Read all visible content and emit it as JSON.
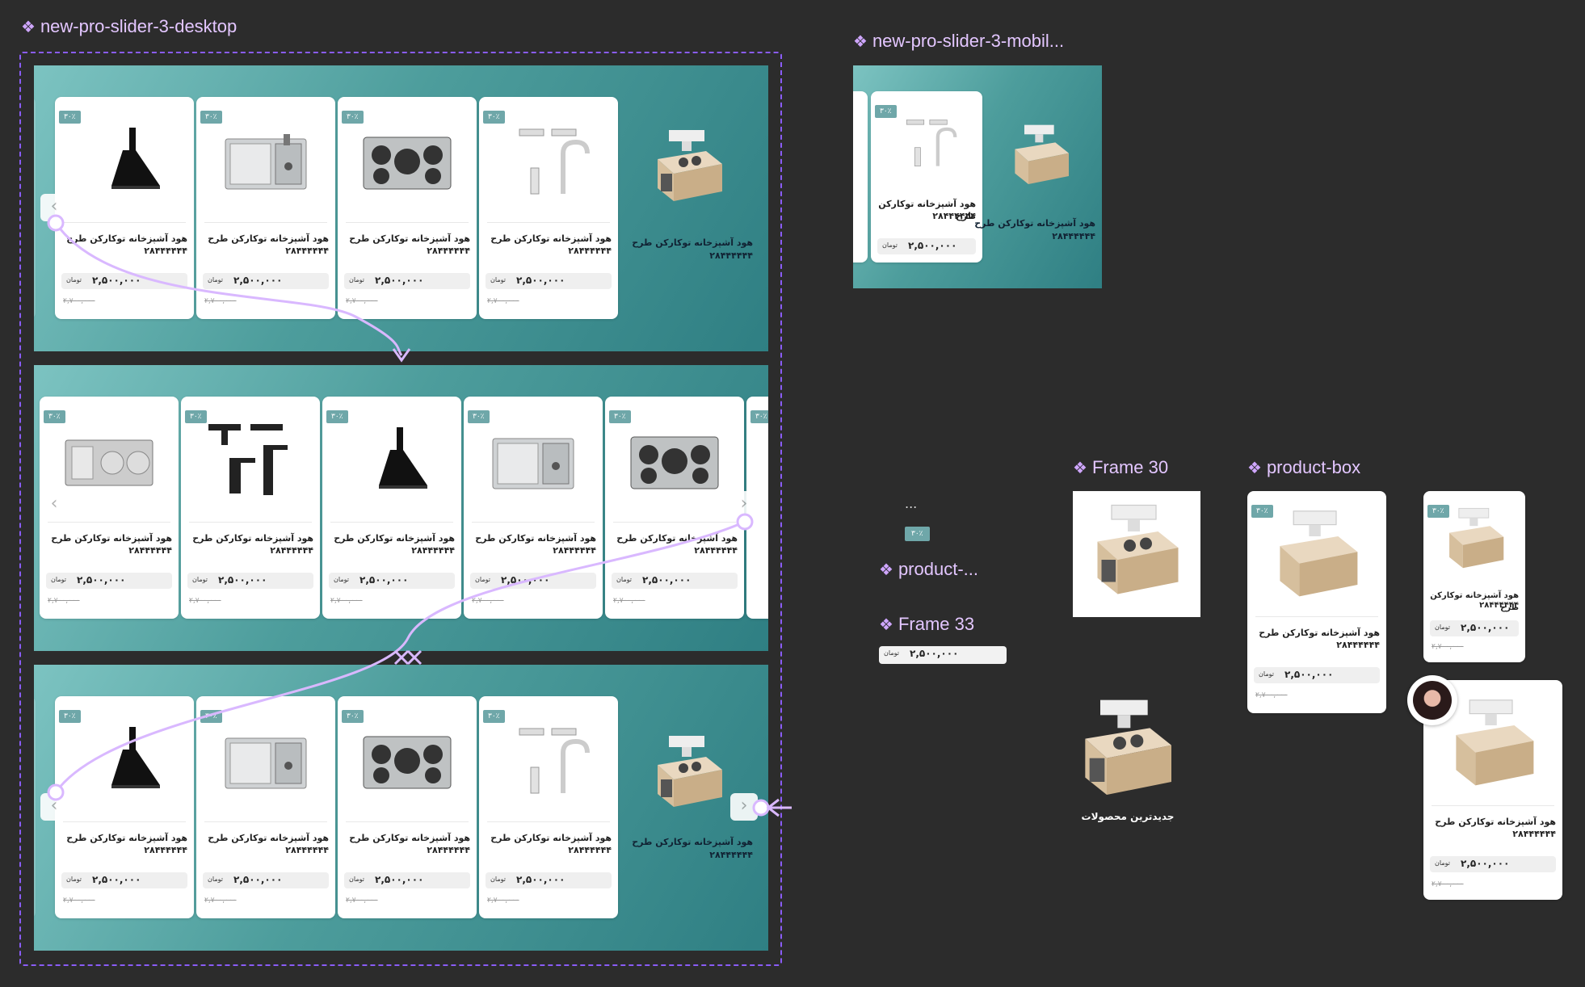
{
  "canvas": {
    "desktop_label": "new-pro-slider-3-desktop",
    "mobile_label": "new-pro-slider-3-mobil...",
    "frame30_label": "Frame 30",
    "productbox_label": "product-box",
    "product_dots_label": "product-...",
    "frame33_label": "Frame 33",
    "ellipsis": "...",
    "newest_products": "جدیدترین محصولات"
  },
  "product": {
    "title": "هود آشپزخانه توکارکن طرح",
    "code": "۲۸۴۴۴۴۴۴",
    "badge": "۳۰٪",
    "price": "۲,۵۰۰,۰۰۰",
    "currency": "تومان",
    "old_price": "۲,۷۰۰,۰۰۰"
  },
  "nav": {
    "prev": "‹",
    "next": "›"
  },
  "icons": {
    "component": "component-icon",
    "prev": "chevron-left-icon",
    "next": "chevron-right-icon",
    "thumbs": [
      "hood-icon",
      "sink-icon",
      "gas-stove-icon",
      "faucet-set-icon",
      "double-sink-icon",
      "mixer-tap-icon",
      "kitchen-island-icon",
      "avatar"
    ]
  },
  "colors": {
    "accent": "#cfa6ff",
    "teal": "#4d9d9c",
    "canvas": "#2c2c2c",
    "badge": "#6fa7a9"
  }
}
